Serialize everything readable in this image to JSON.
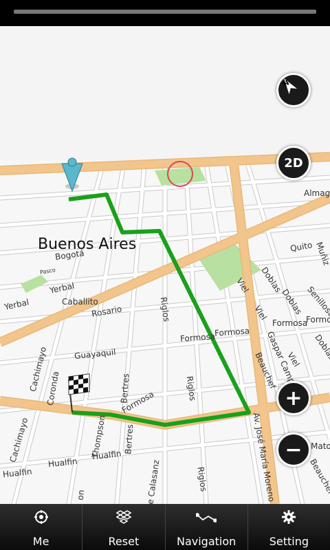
{
  "map": {
    "city_label": "Buenos Aires",
    "streets": {
      "bogota": "Bogotá",
      "yerbal_left": "Yerbal",
      "yerbal_center": "Yerbal",
      "caballito": "Caballito",
      "rosario": "Rosario",
      "riglos_top": "Riglos",
      "riglos_mid": "Riglos",
      "riglos_bottom": "Riglos",
      "guayaquil": "Guayaquil",
      "cachimayo_top": "Cachimayo",
      "cachimayo_bottom": "Cachimayo",
      "coronda": "Coronda",
      "bertres_top": "Bertres",
      "bertres_bottom": "Bertres",
      "formosa_left": "Formosa",
      "formosa_center": "Formosa",
      "formosa_center2": "Formosa",
      "formosa_right": "Formosa",
      "formosa_right2": "Formosa",
      "thompson": "Thompson",
      "hualfin_left": "Hualfin",
      "hualfin_center": "Hualfin",
      "hualfin_right": "Hualfin",
      "calasanz": "de Calasanz",
      "moreno": "Av. José María Moreno",
      "beauchef_top": "Beauchef",
      "beauchef_bottom": "Beauchef",
      "gaspar_campos": "Gaspar Camp",
      "viel_top": "Viel",
      "viel_mid": "Viel",
      "viel_bottom": "Viel",
      "doblas_1": "Doblas",
      "doblas_2": "Doblas",
      "doblas_3": "Doblas",
      "senillosa": "Senillosa",
      "quito": "Quito",
      "muniz": "Muñiz",
      "almagro": "Almagr",
      "matorras": "Mator",
      "on": "on",
      "pasco": "Pasco"
    },
    "compass_icon": "compass-north-icon",
    "view_mode_label": "2D",
    "zoom_in_label": "+",
    "zoom_out_label": "−",
    "route_color": "#1aa01a",
    "avenue_color": "#f2c58c"
  },
  "bottom_nav": [
    {
      "label": "Me",
      "icon": "crosshair-icon"
    },
    {
      "label": "Reset",
      "icon": "dropbox-icon"
    },
    {
      "label": "Navigation",
      "icon": "route-icon"
    },
    {
      "label": "Setting",
      "icon": "gear-icon"
    }
  ]
}
